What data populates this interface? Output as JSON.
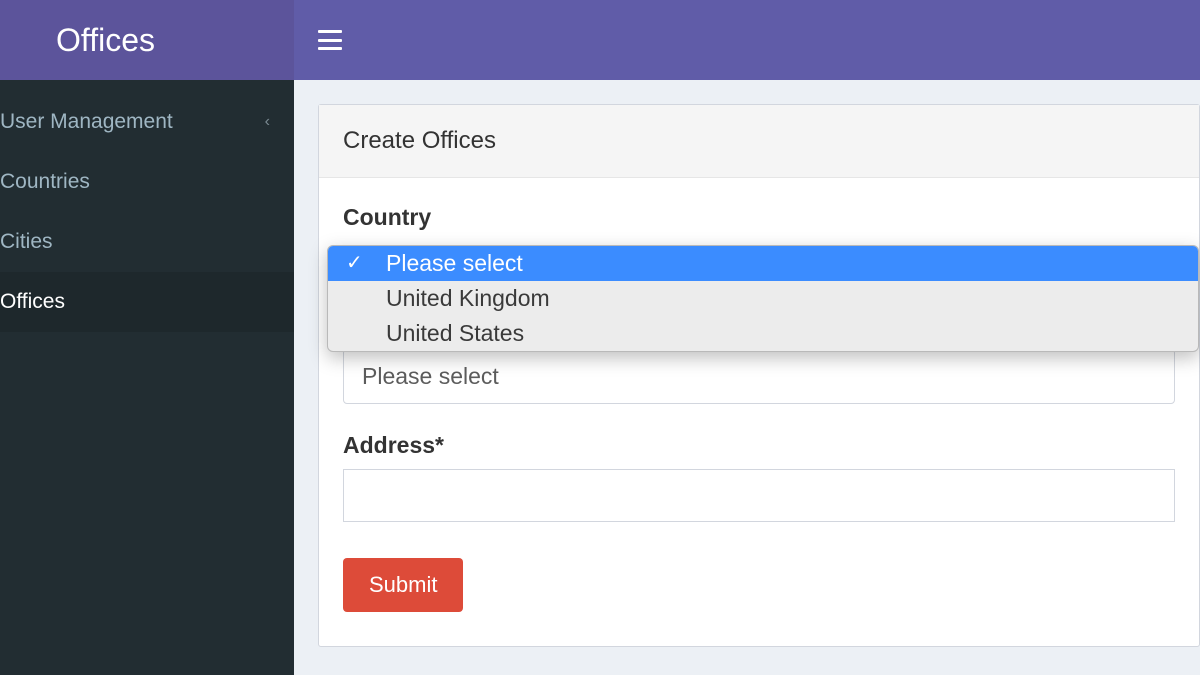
{
  "header": {
    "brand": "Offices"
  },
  "sidebar": {
    "items": [
      {
        "label": "User Management",
        "has_children": true
      },
      {
        "label": "Countries",
        "has_children": false
      },
      {
        "label": "Cities",
        "has_children": false
      },
      {
        "label": "Offices",
        "has_children": false,
        "active": true
      }
    ]
  },
  "panel": {
    "title": "Create Offices",
    "form": {
      "country_label": "Country",
      "country_options": [
        {
          "label": "Please select",
          "selected": true
        },
        {
          "label": "United Kingdom",
          "selected": false
        },
        {
          "label": "United States",
          "selected": false
        }
      ],
      "city_placeholder": "Please select",
      "address_label": "Address*",
      "address_value": "",
      "submit_label": "Submit"
    }
  },
  "icons": {
    "check": "✓",
    "chevron_left": "‹"
  }
}
